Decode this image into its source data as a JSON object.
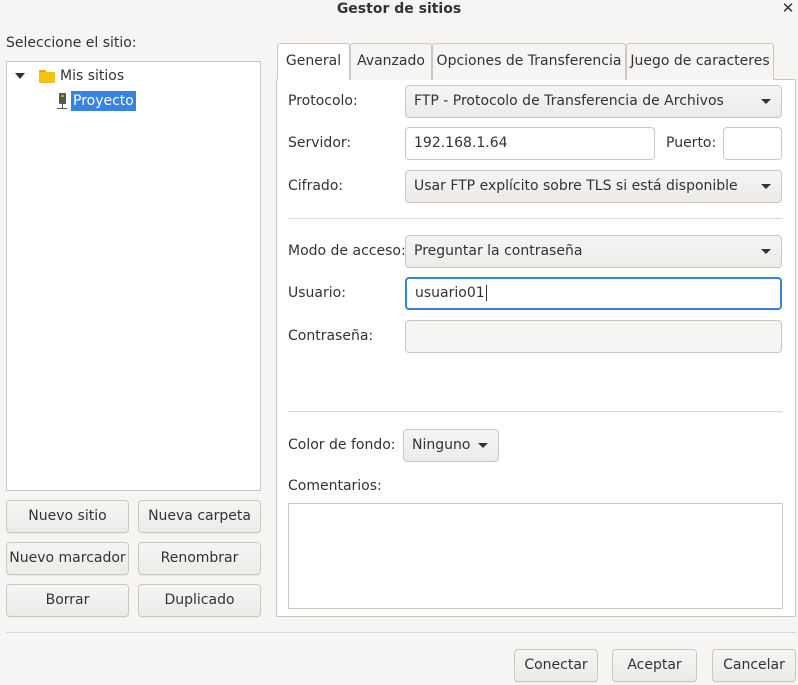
{
  "window": {
    "title": "Gestor de sitios",
    "close_glyph": "✕"
  },
  "left": {
    "select_label": "Seleccione el sitio:",
    "tree": {
      "root_label": "Mis sitios",
      "child_label": "Proyecto"
    },
    "buttons": {
      "new_site": "Nuevo sitio",
      "new_folder": "Nueva carpeta",
      "new_bookmark": "Nuevo marcador",
      "rename": "Renombrar",
      "delete": "Borrar",
      "duplicate": "Duplicado"
    }
  },
  "tabs": [
    {
      "label": "General",
      "active": true
    },
    {
      "label": "Avanzado",
      "active": false
    },
    {
      "label": "Opciones de Transferencia",
      "active": false
    },
    {
      "label": "Juego de caracteres",
      "active": false
    }
  ],
  "general": {
    "protocol_label": "Protocolo:",
    "protocol_value": "FTP - Protocolo de Transferencia de Archivos",
    "server_label": "Servidor:",
    "server_value": "192.168.1.64",
    "port_label": "Puerto:",
    "port_value": "",
    "encryption_label": "Cifrado:",
    "encryption_value": "Usar FTP explícito sobre TLS si está disponible",
    "logon_label": "Modo de acceso:",
    "logon_value": "Preguntar la contraseña",
    "user_label": "Usuario:",
    "user_value": "usuario01",
    "password_label": "Contraseña:",
    "password_value": "",
    "bgcolor_label": "Color de fondo:",
    "bgcolor_value": "Ninguno",
    "comments_label": "Comentarios:",
    "comments_value": ""
  },
  "footer": {
    "connect": "Conectar",
    "ok": "Aceptar",
    "cancel": "Cancelar"
  },
  "colors": {
    "accent": "#3584e4",
    "folder": "#f5c211",
    "background": "#f6f5f4",
    "border": "#cdc7c2"
  },
  "icons": {
    "close": "close-icon",
    "expander": "expander-icon",
    "folder": "folder-icon",
    "server": "server-icon",
    "dropdown": "chevron-down-icon"
  }
}
